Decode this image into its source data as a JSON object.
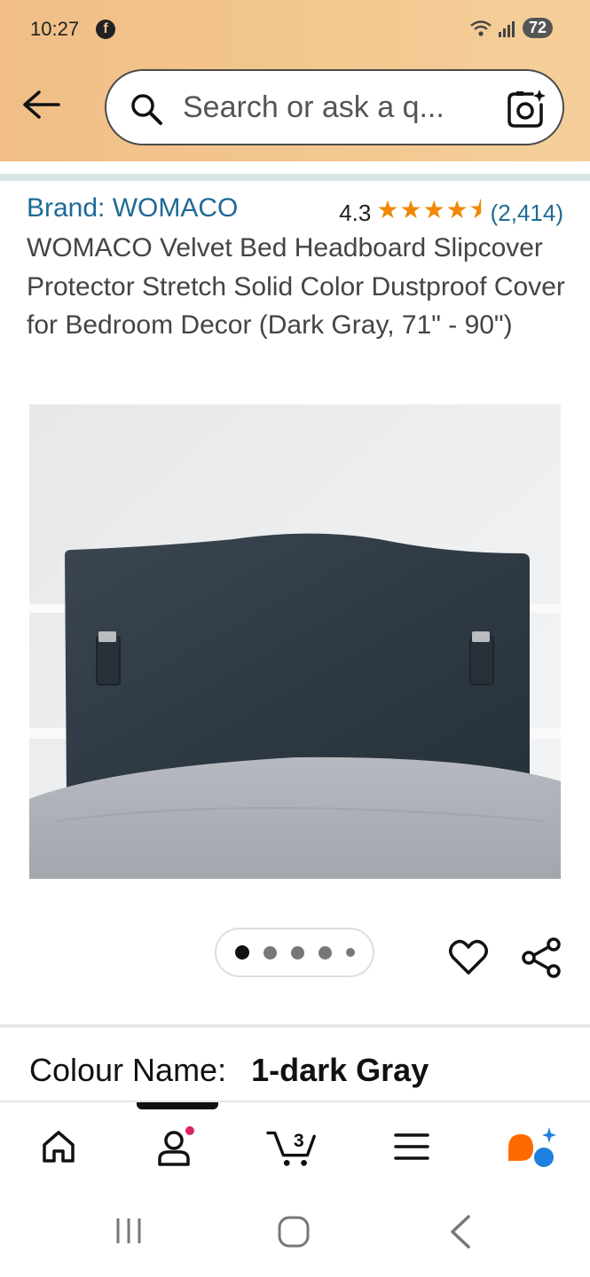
{
  "status": {
    "time": "10:27",
    "fb_label": "f",
    "battery": "72"
  },
  "search": {
    "placeholder": "Search or ask a q..."
  },
  "product": {
    "brand": "Brand: WOMACO",
    "rating": "4.3",
    "stars": "★★★★⯨",
    "review_count": "(2,414)",
    "title": "WOMACO Velvet Bed Headboard Slipcover Protector Stretch Solid Color Dustproof Cover for Bedroom Decor (Dark Gray, 71\" - 90\")",
    "image_pages": 5,
    "image_active": 1,
    "colour_label": "Colour Name:",
    "colour_value": "1-dark Gray"
  },
  "cart": {
    "count": "3"
  },
  "colors": {
    "brand_link": "#1f6a96",
    "star": "#f08804",
    "topbar": "#f3c891",
    "badge": "#e0245e"
  },
  "icons": [
    "back-arrow-icon",
    "search-icon",
    "camera-lens-icon",
    "heart-icon",
    "share-icon",
    "home-icon",
    "account-icon",
    "cart-icon",
    "menu-icon",
    "rufus-icon",
    "recents-icon",
    "home-button-icon",
    "back-icon"
  ]
}
